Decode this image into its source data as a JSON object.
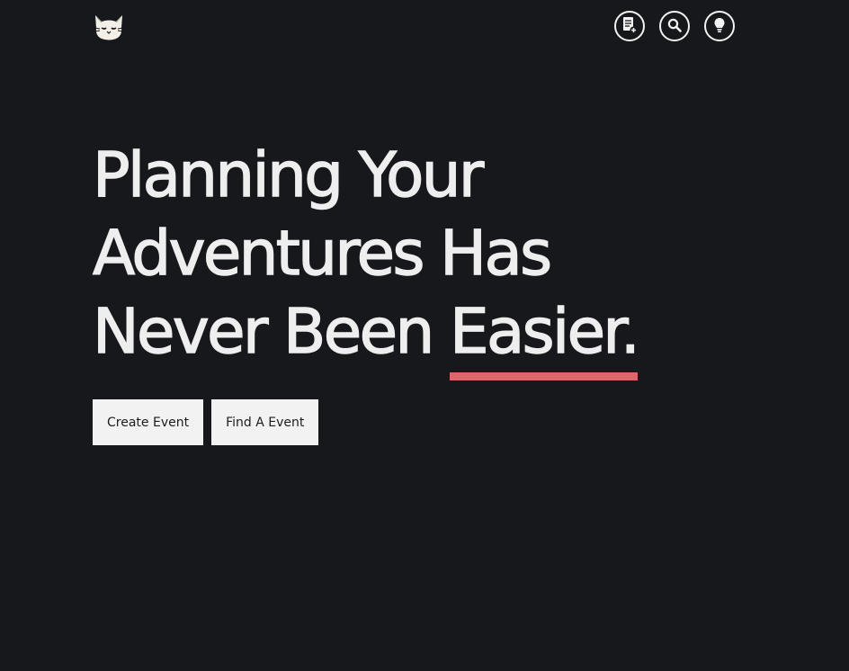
{
  "header": {
    "logo_icon": "cat-face-icon",
    "nav": [
      {
        "icon": "document-add-icon"
      },
      {
        "icon": "search-icon"
      },
      {
        "icon": "lightbulb-icon"
      }
    ]
  },
  "hero": {
    "line1": "Planning Your",
    "line2": "Adventures Has",
    "line3_prefix": "Never Been ",
    "line3_accent": "Easier.",
    "accent_color": "#e0656b"
  },
  "actions": {
    "create_label": "Create Event",
    "find_label": "Find A Event"
  },
  "colors": {
    "background": "#17181c",
    "text": "#eeeeee",
    "button_bg": "#f2f2f2"
  }
}
